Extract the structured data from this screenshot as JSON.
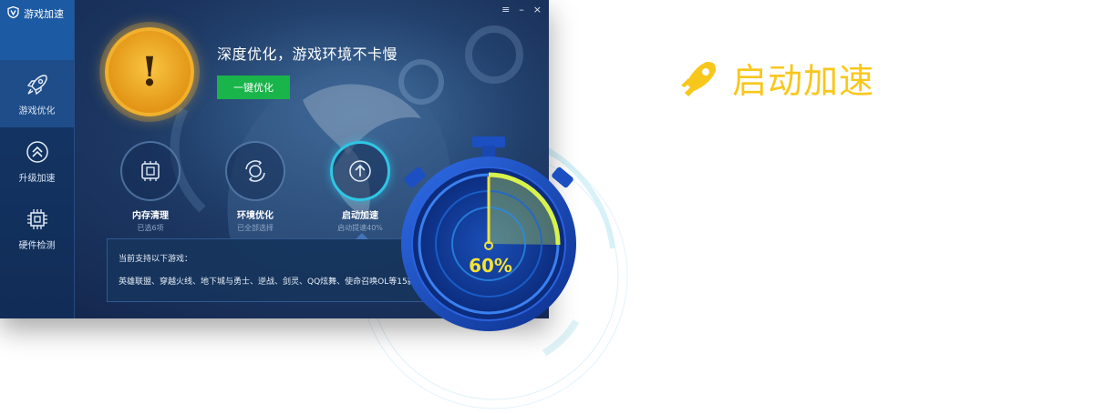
{
  "app": {
    "title": "游戏加速",
    "window_controls": {
      "menu": "≡",
      "minimize": "–",
      "close": "×"
    },
    "sidebar": {
      "items": [
        {
          "label": "游戏优化",
          "icon": "rocket-icon"
        },
        {
          "label": "升级加速",
          "icon": "upgrade-chevrons-icon"
        },
        {
          "label": "硬件检测",
          "icon": "chip-icon"
        }
      ]
    },
    "hero": {
      "status_icon": "warning-exclamation-icon",
      "status_symbol": "!",
      "headline": "深度优化，游戏环境不卡慢",
      "button_label": "一键优化"
    },
    "features": [
      {
        "title": "内存清理",
        "sub": "已选6项",
        "icon": "memory-chip-icon"
      },
      {
        "title": "环境优化",
        "sub": "已全部选择",
        "icon": "refresh-circle-icon"
      },
      {
        "title": "启动加速",
        "sub": "启动提速40%",
        "icon": "upload-arrow-icon"
      }
    ],
    "panel": {
      "line1": "当前支持以下游戏：",
      "line2": "英雄联盟、穿越火线、地下城与勇士、逆战、剑灵、QQ炫舞、使命召唤OL等15款"
    }
  },
  "stopwatch": {
    "progress_percent": 60,
    "label": "60%"
  },
  "feature_title": {
    "text": "启动加速",
    "icon": "boost-logo-icon"
  },
  "colors": {
    "accent_yellow": "#f8c71b",
    "button_green": "#19b44a",
    "gauge_fill": "#c9ef4a",
    "warning_orange": "#f2b12c"
  }
}
